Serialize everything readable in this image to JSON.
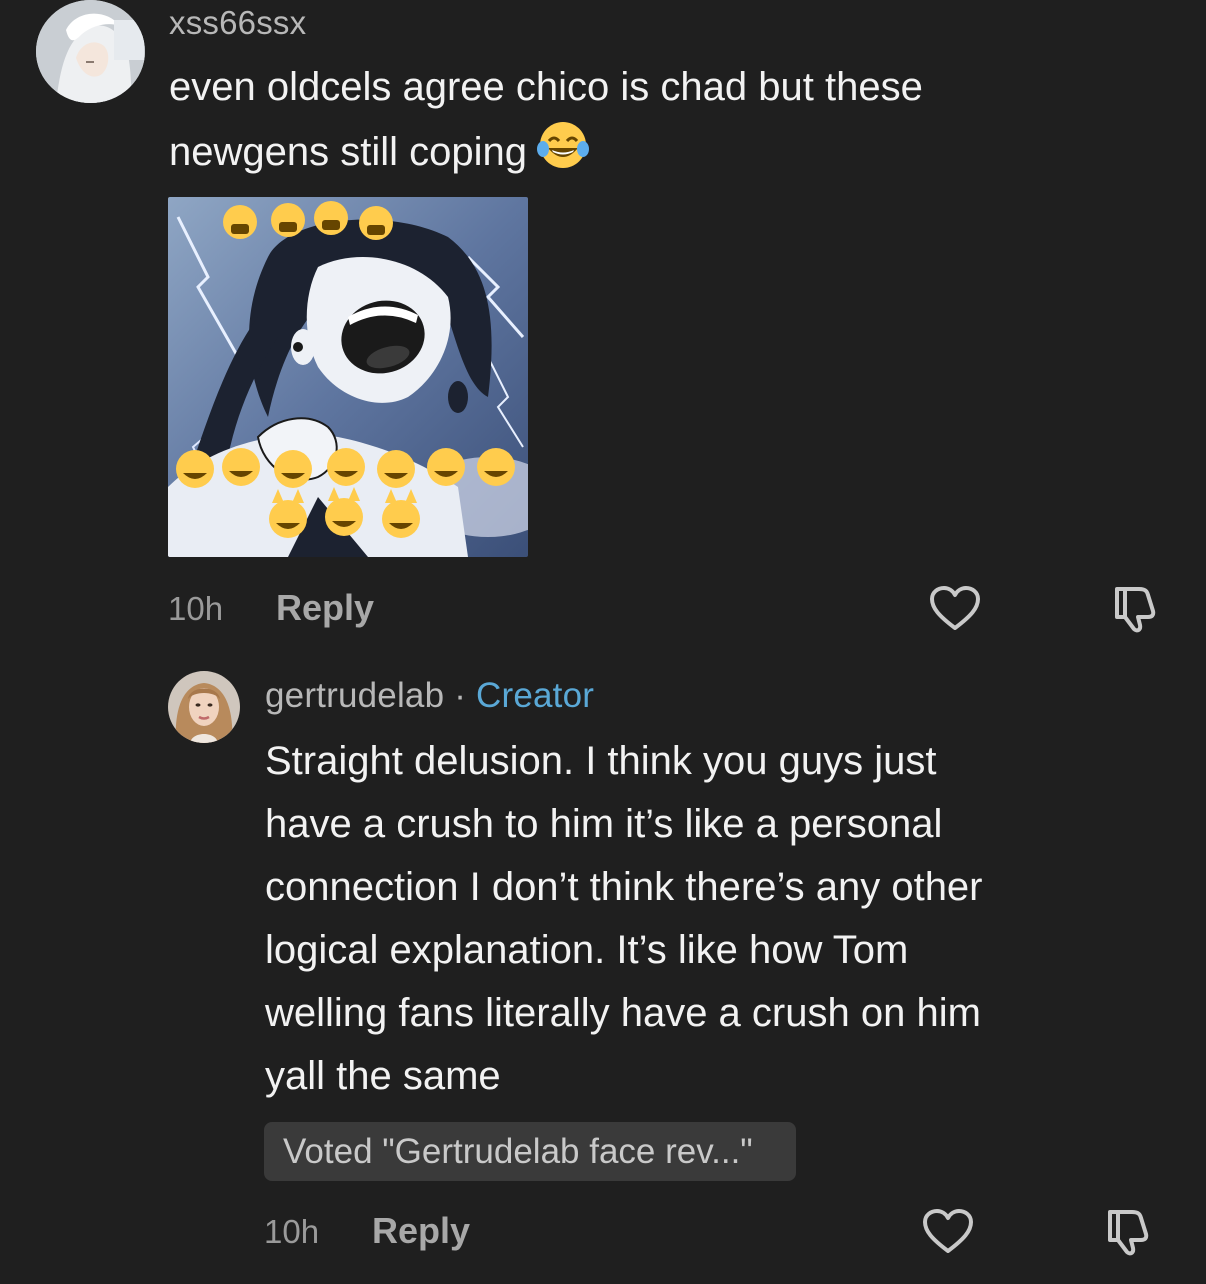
{
  "comment": {
    "username": "xss66ssx",
    "text_line1": "even oldcels agree chico is chad but these",
    "text_line2": "newgens still coping",
    "emoji": "tears-of-joy-emoji",
    "time": "10h",
    "reply_label": "Reply"
  },
  "reply": {
    "username": "gertrudelab",
    "separator": "·",
    "badge": "Creator",
    "lines": [
      "Straight delusion. I think you guys just",
      "have a crush to him it’s like a personal",
      "connection I don’t think there’s any other",
      "logical explanation. It’s like how Tom",
      "welling fans literally have a crush on him",
      "yall the same"
    ],
    "vote": "Voted \"Gertrudelab face rev...\"",
    "time": "10h",
    "reply_label": "Reply"
  },
  "icons": {
    "like": "heart-outline-icon",
    "dislike": "thumbs-down-icon"
  },
  "colors": {
    "background": "#1f1f1f",
    "creator_badge": "#5aa8d6",
    "vote_pill": "#3a3a3a"
  }
}
